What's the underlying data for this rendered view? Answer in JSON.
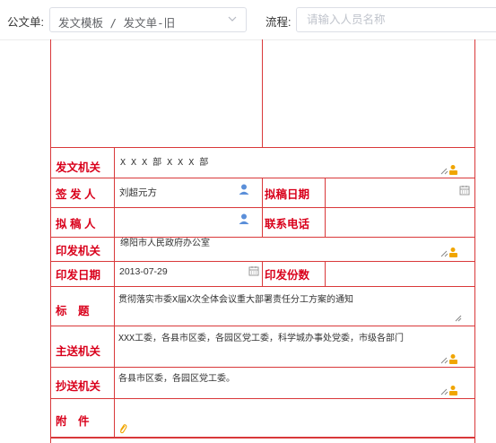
{
  "toolbar": {
    "doc_label": "公文单:",
    "doc_value": "发文模板 / 发文单-旧",
    "flow_label": "流程:",
    "flow_placeholder": "请输入人员名称"
  },
  "form": {
    "fawen_jiguan": {
      "label": "发文机关",
      "value": "X X X 部 X X X 部"
    },
    "qianfa_ren": {
      "label": "签 发 人",
      "value": "刘超元方"
    },
    "nigao_riqi": {
      "label": "拟稿日期",
      "value": ""
    },
    "nigao_ren": {
      "label": "拟 稿 人",
      "value": ""
    },
    "lianxi_dianhua": {
      "label": "联系电话",
      "value": ""
    },
    "yinfa_jiguan": {
      "label": "印发机关",
      "value": "绵阳市人民政府办公室"
    },
    "yinfa_riqi": {
      "label": "印发日期",
      "value": "2013-07-29"
    },
    "yinfa_fenshu": {
      "label": "印发份数",
      "value": ""
    },
    "biaoti": {
      "label": "标　题",
      "value": "贯彻落实市委X届X次全体会议重大部署责任分工方案的通知"
    },
    "zhusong_jiguan": {
      "label": "主送机关",
      "value": "XXX工委，各县市区委，各园区党工委，科学城办事处党委，市级各部门"
    },
    "chaosong_jiguan": {
      "label": "抄送机关",
      "value": "各县市区委，各园区党工委。"
    },
    "fujian": {
      "label": "附　件",
      "value": ""
    }
  },
  "colors": {
    "accent_red": "#d9001b",
    "border_red": "#d9383a",
    "user_icon": "#5b8fd9",
    "picker_yellow": "#f0a500"
  },
  "icons": [
    "chevron-down-icon",
    "person-picker-icon",
    "user-icon",
    "calendar-icon",
    "resize-handle-icon",
    "paperclip-icon"
  ]
}
